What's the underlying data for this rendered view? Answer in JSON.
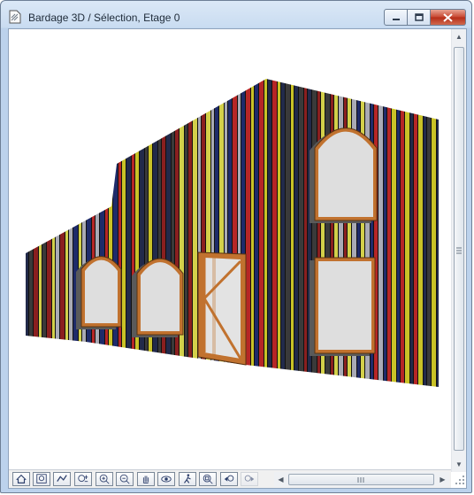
{
  "window": {
    "title": "Bardage 3D / Sélection, Etage 0",
    "icon": "document-icon",
    "controls": [
      {
        "name": "minimize-button",
        "icon": "minimize-icon"
      },
      {
        "name": "maximize-button",
        "icon": "maximize-icon"
      },
      {
        "name": "close-button",
        "icon": "close-icon"
      }
    ]
  },
  "viewport": {
    "content": "3D view of a wall with vertical multicolored cladding, arched windows and a door"
  },
  "toolbar": {
    "tools": [
      {
        "name": "home-view-icon"
      },
      {
        "name": "zoom-to-fit-icon"
      },
      {
        "name": "navigation-icon"
      },
      {
        "name": "zoom-plus-minus-icon"
      },
      {
        "name": "zoom-in-icon"
      },
      {
        "name": "zoom-out-icon"
      },
      {
        "name": "pan-hand-icon"
      },
      {
        "name": "orbit-icon"
      },
      {
        "name": "walk-icon"
      },
      {
        "name": "zoom-region-icon"
      },
      {
        "name": "previous-view-icon"
      },
      {
        "name": "next-view-icon",
        "disabled": true
      }
    ]
  },
  "colors": {
    "cladding": [
      "#222a4a",
      "#1e2b6a",
      "#8a1f1f",
      "#c9c227",
      "#a9aab5",
      "#3a3a3a",
      "#b62626",
      "#d3d04a"
    ],
    "frame_wood": "#c1722f",
    "glass": "#dedede",
    "title_bar": "#c9dcf1"
  }
}
